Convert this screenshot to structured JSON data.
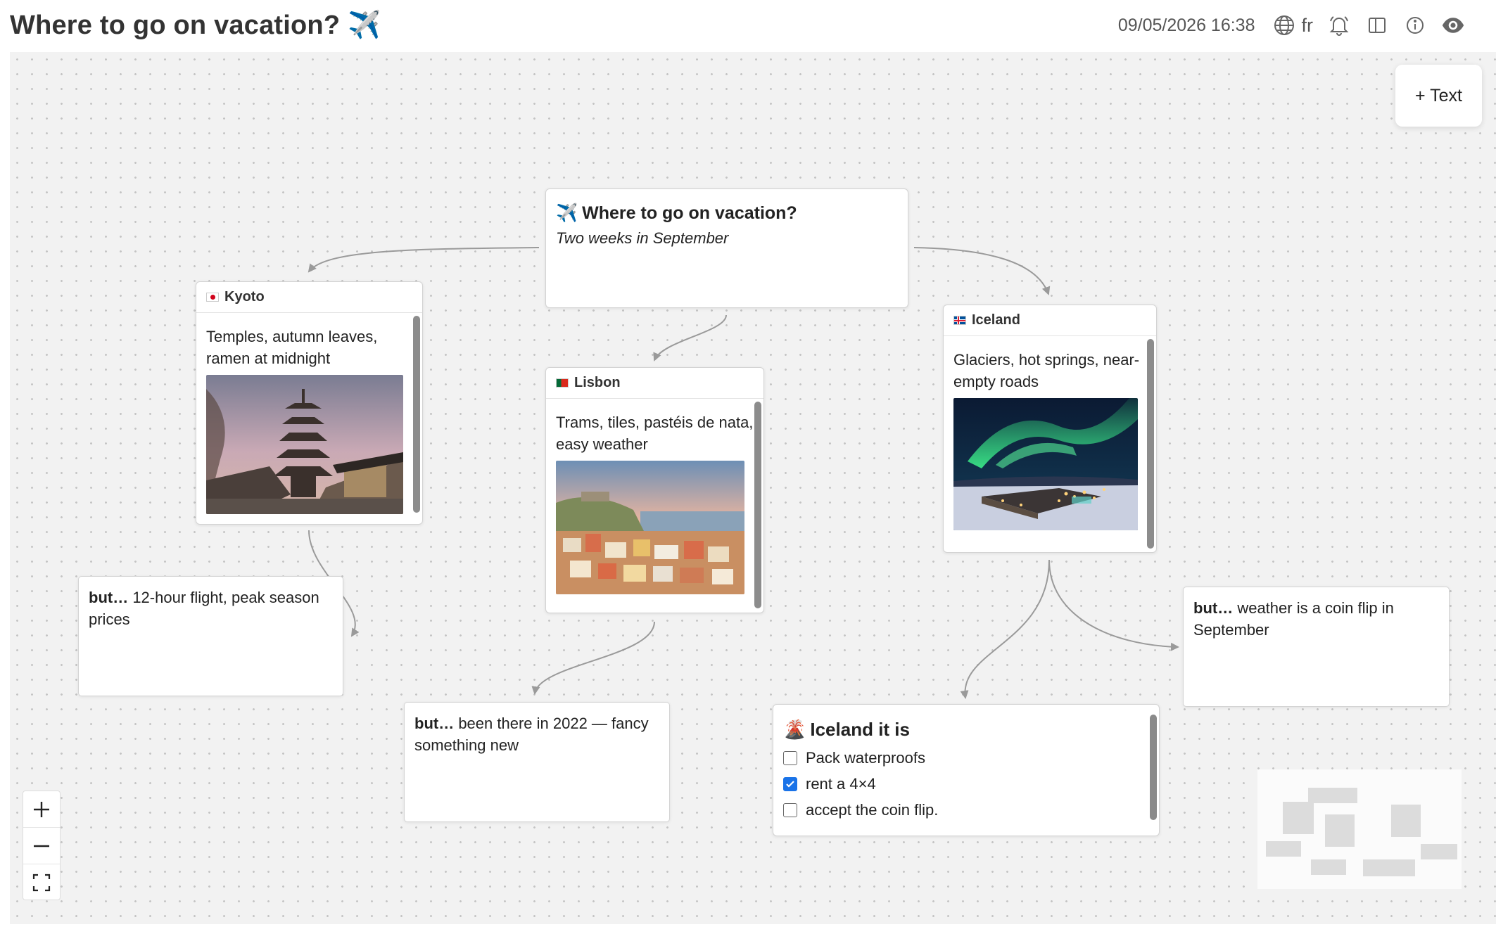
{
  "header": {
    "title": "Where to go on vacation? ✈️",
    "datetime": "09/05/2026 16:38",
    "language": "fr",
    "icons": [
      "globe-icon",
      "bell-icon",
      "split-view-icon",
      "info-icon",
      "eye-icon"
    ]
  },
  "toolbar": {
    "add_text_label": "+ Text"
  },
  "root_card": {
    "emoji": "✈️",
    "title": "Where to go on vacation?",
    "subtitle": "Two weeks in September"
  },
  "cards": {
    "kyoto": {
      "flag": "Japan flag",
      "title": "Kyoto",
      "text": "Temples, autumn leaves, ramen at midnight",
      "image": "pagoda-photo"
    },
    "lisbon": {
      "flag": "Portugal flag",
      "title": "Lisbon",
      "text": "Trams, tiles, pastéis de nata, easy weather",
      "image": "lisbon-city-photo"
    },
    "iceland": {
      "flag": "Iceland flag",
      "title": "Iceland",
      "text": "Glaciers, hot springs, near-empty roads",
      "image": "aurora-photo"
    }
  },
  "notes": {
    "kyoto_but": {
      "lead": "but…",
      "text": " 12-hour flight, peak season prices"
    },
    "lisbon_but": {
      "lead": "but…",
      "text": " been there in 2022 — fancy something new"
    },
    "iceland_but": {
      "lead": "but…",
      "text": " weather is a coin flip in September"
    }
  },
  "checklist": {
    "emoji": "🌋",
    "title": "Iceland it is",
    "items": [
      {
        "label": "Pack waterproofs",
        "checked": false
      },
      {
        "label": "rent a 4×4",
        "checked": true
      },
      {
        "label": "accept the coin flip.",
        "checked": false
      }
    ]
  },
  "zoom_controls": [
    "plus-icon",
    "minus-icon",
    "fit-view-icon"
  ],
  "colors": {
    "canvas": "#f2f2f2",
    "accent": "#1a73e8",
    "edge": "#9a9a9a"
  }
}
